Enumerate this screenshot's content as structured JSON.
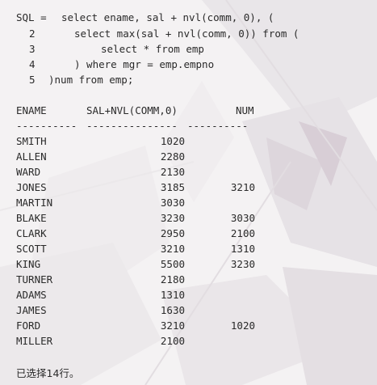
{
  "sql": {
    "prompt": "SQL =",
    "lines": [
      {
        "num": "",
        "text": "select ename, sal + nvl(comm, 0), ("
      },
      {
        "num": "2",
        "text": "select max(sal + nvl(comm, 0)) from ("
      },
      {
        "num": "3",
        "text": "select * from emp"
      },
      {
        "num": "4",
        "text": ") where mgr = emp.empno"
      },
      {
        "num": "5",
        "text": ")num from emp;"
      }
    ]
  },
  "table": {
    "headers": [
      "ENAME",
      "SAL+NVL(COMM,0)",
      "NUM"
    ],
    "separators": [
      "----------",
      "---------------",
      "----------"
    ],
    "rows": [
      [
        "SMITH",
        "1020",
        ""
      ],
      [
        "ALLEN",
        "2280",
        ""
      ],
      [
        "WARD",
        "2130",
        ""
      ],
      [
        "JONES",
        "3185",
        "3210"
      ],
      [
        "MARTIN",
        "3030",
        ""
      ],
      [
        "BLAKE",
        "3230",
        "3030"
      ],
      [
        "CLARK",
        "2950",
        "2100"
      ],
      [
        "SCOTT",
        "3210",
        "1310"
      ],
      [
        "KING",
        "5500",
        "3230"
      ],
      [
        "TURNER",
        "2180",
        ""
      ],
      [
        "ADAMS",
        "1310",
        ""
      ],
      [
        "JAMES",
        "1630",
        ""
      ],
      [
        "FORD",
        "3210",
        "1020"
      ],
      [
        "MILLER",
        "2100",
        ""
      ]
    ]
  },
  "footer": "已选择14行。"
}
